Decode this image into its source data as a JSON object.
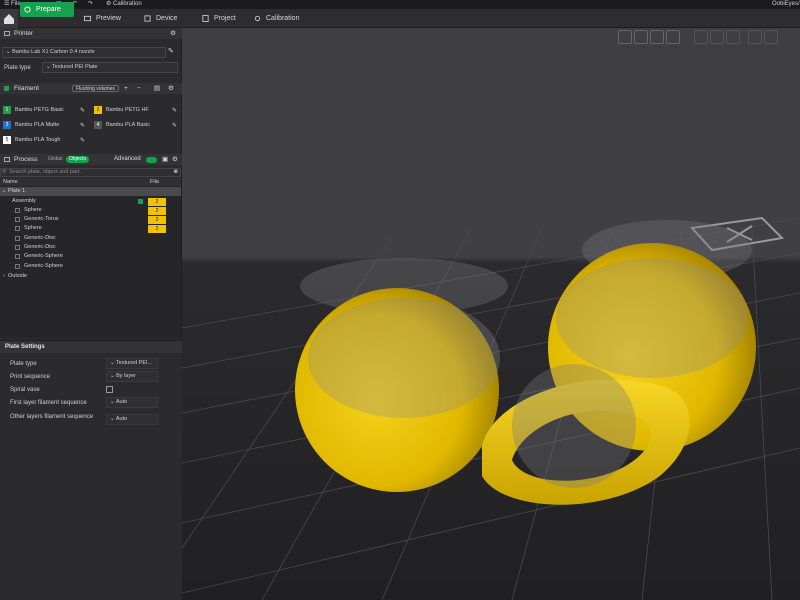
{
  "titlebar": {
    "file_menu": "File",
    "calibration": "Calibration",
    "app_name": "OobiEyes/Ch"
  },
  "tabs": [
    {
      "label": "Prepare"
    },
    {
      "label": "Preview"
    },
    {
      "label": "Device"
    },
    {
      "label": "Project"
    },
    {
      "label": "Calibration"
    }
  ],
  "printer": {
    "header": "Printer",
    "name": "Bambu Lab X1 Carbon 0.4 nozzle",
    "plate_type_label": "Plate type",
    "plate_type_value": "Textured PEI Plate"
  },
  "filament": {
    "header": "Filament",
    "flushing_button": "Flushing volumes",
    "items": [
      {
        "num": "1",
        "name": "Bambu PETG Basic",
        "color": "#16a34a"
      },
      {
        "num": "2",
        "name": "Bambu PETG HF",
        "color": "#f2c200"
      },
      {
        "num": "3",
        "name": "Bambu PLA Matte",
        "color": "#1f6fd1"
      },
      {
        "num": "4",
        "name": "Bambu PLA Basic",
        "color": "#555555"
      },
      {
        "num": "5",
        "name": "Bambu PLA Tough",
        "color": "#ffffff"
      }
    ]
  },
  "process": {
    "header": "Process",
    "global": "Global",
    "objects": "Objects",
    "advanced": "Advanced"
  },
  "tree": {
    "search_placeholder": "Search plate, object and part.",
    "col_name": "Name",
    "col_fila": "Fila",
    "rows": [
      {
        "name": "Plate 1",
        "level": 0,
        "badge": ""
      },
      {
        "name": "Assembly",
        "level": 1,
        "badge": "2"
      },
      {
        "name": "Sphere",
        "level": 2,
        "badge": "2"
      },
      {
        "name": "Generic-Torus",
        "level": 2,
        "badge": "2"
      },
      {
        "name": "Sphere",
        "level": 2,
        "badge": "2"
      },
      {
        "name": "Generic-Disc",
        "level": 2,
        "badge": ""
      },
      {
        "name": "Generic-Disc",
        "level": 2,
        "badge": ""
      },
      {
        "name": "Generic-Sphere",
        "level": 2,
        "badge": ""
      },
      {
        "name": "Generic-Sphere",
        "level": 2,
        "badge": ""
      },
      {
        "name": "Outside",
        "level": 0,
        "badge": ""
      }
    ]
  },
  "plate_settings": {
    "title": "Plate Settings",
    "rows": [
      {
        "label": "Plate type",
        "value": "Textured PEI..."
      },
      {
        "label": "Print sequence",
        "value": "By layer"
      },
      {
        "label": "Spiral vase",
        "value": ""
      },
      {
        "label": "First layer filament sequence",
        "value": "Auto"
      },
      {
        "label": "Other layers filament sequence",
        "value": "Auto"
      }
    ]
  },
  "colors": {
    "accent": "#14a34c",
    "model": "#f2c200"
  }
}
